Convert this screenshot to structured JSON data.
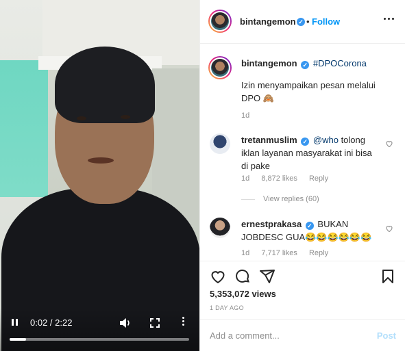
{
  "video": {
    "time_display": "0:02 / 2:22",
    "progress_fraction": 0.09
  },
  "header": {
    "username": "bintangemon",
    "separator": "•",
    "follow_label": "Follow"
  },
  "caption": {
    "username": "bintangemon",
    "hashtag": "#DPOCorona",
    "text_line1": "Izin menyampaikan pesan melalui",
    "text_line2": "DPO 🙈",
    "age": "1d"
  },
  "comments": [
    {
      "username": "tretanmuslim",
      "mention": "@who",
      "text_line1": "tolong",
      "text_line2": "iklan layanan masyarakat ini bisa",
      "text_line3": "di pake",
      "age": "1d",
      "likes": "8,872 likes",
      "reply_label": "Reply",
      "view_replies": "View replies (60)"
    },
    {
      "username": "ernestprakasa",
      "text_line1": "BUKAN",
      "text_line2": "JOBDESC GUA😂😂😂😂😂😂",
      "age": "1d",
      "likes": "7,717 likes",
      "reply_label": "Reply"
    }
  ],
  "stats": {
    "views": "5,353,072 views",
    "posted": "1 DAY AGO"
  },
  "composer": {
    "placeholder": "Add a comment...",
    "post_label": "Post"
  },
  "icons": {
    "verified": "verified-badge-icon",
    "heart": "heart-icon",
    "comment": "comment-icon",
    "share": "share-icon",
    "save": "bookmark-icon"
  },
  "colors": {
    "link_blue": "#0095f6",
    "verified_blue": "#3897f0",
    "muted_gray": "#8e8e8e"
  }
}
